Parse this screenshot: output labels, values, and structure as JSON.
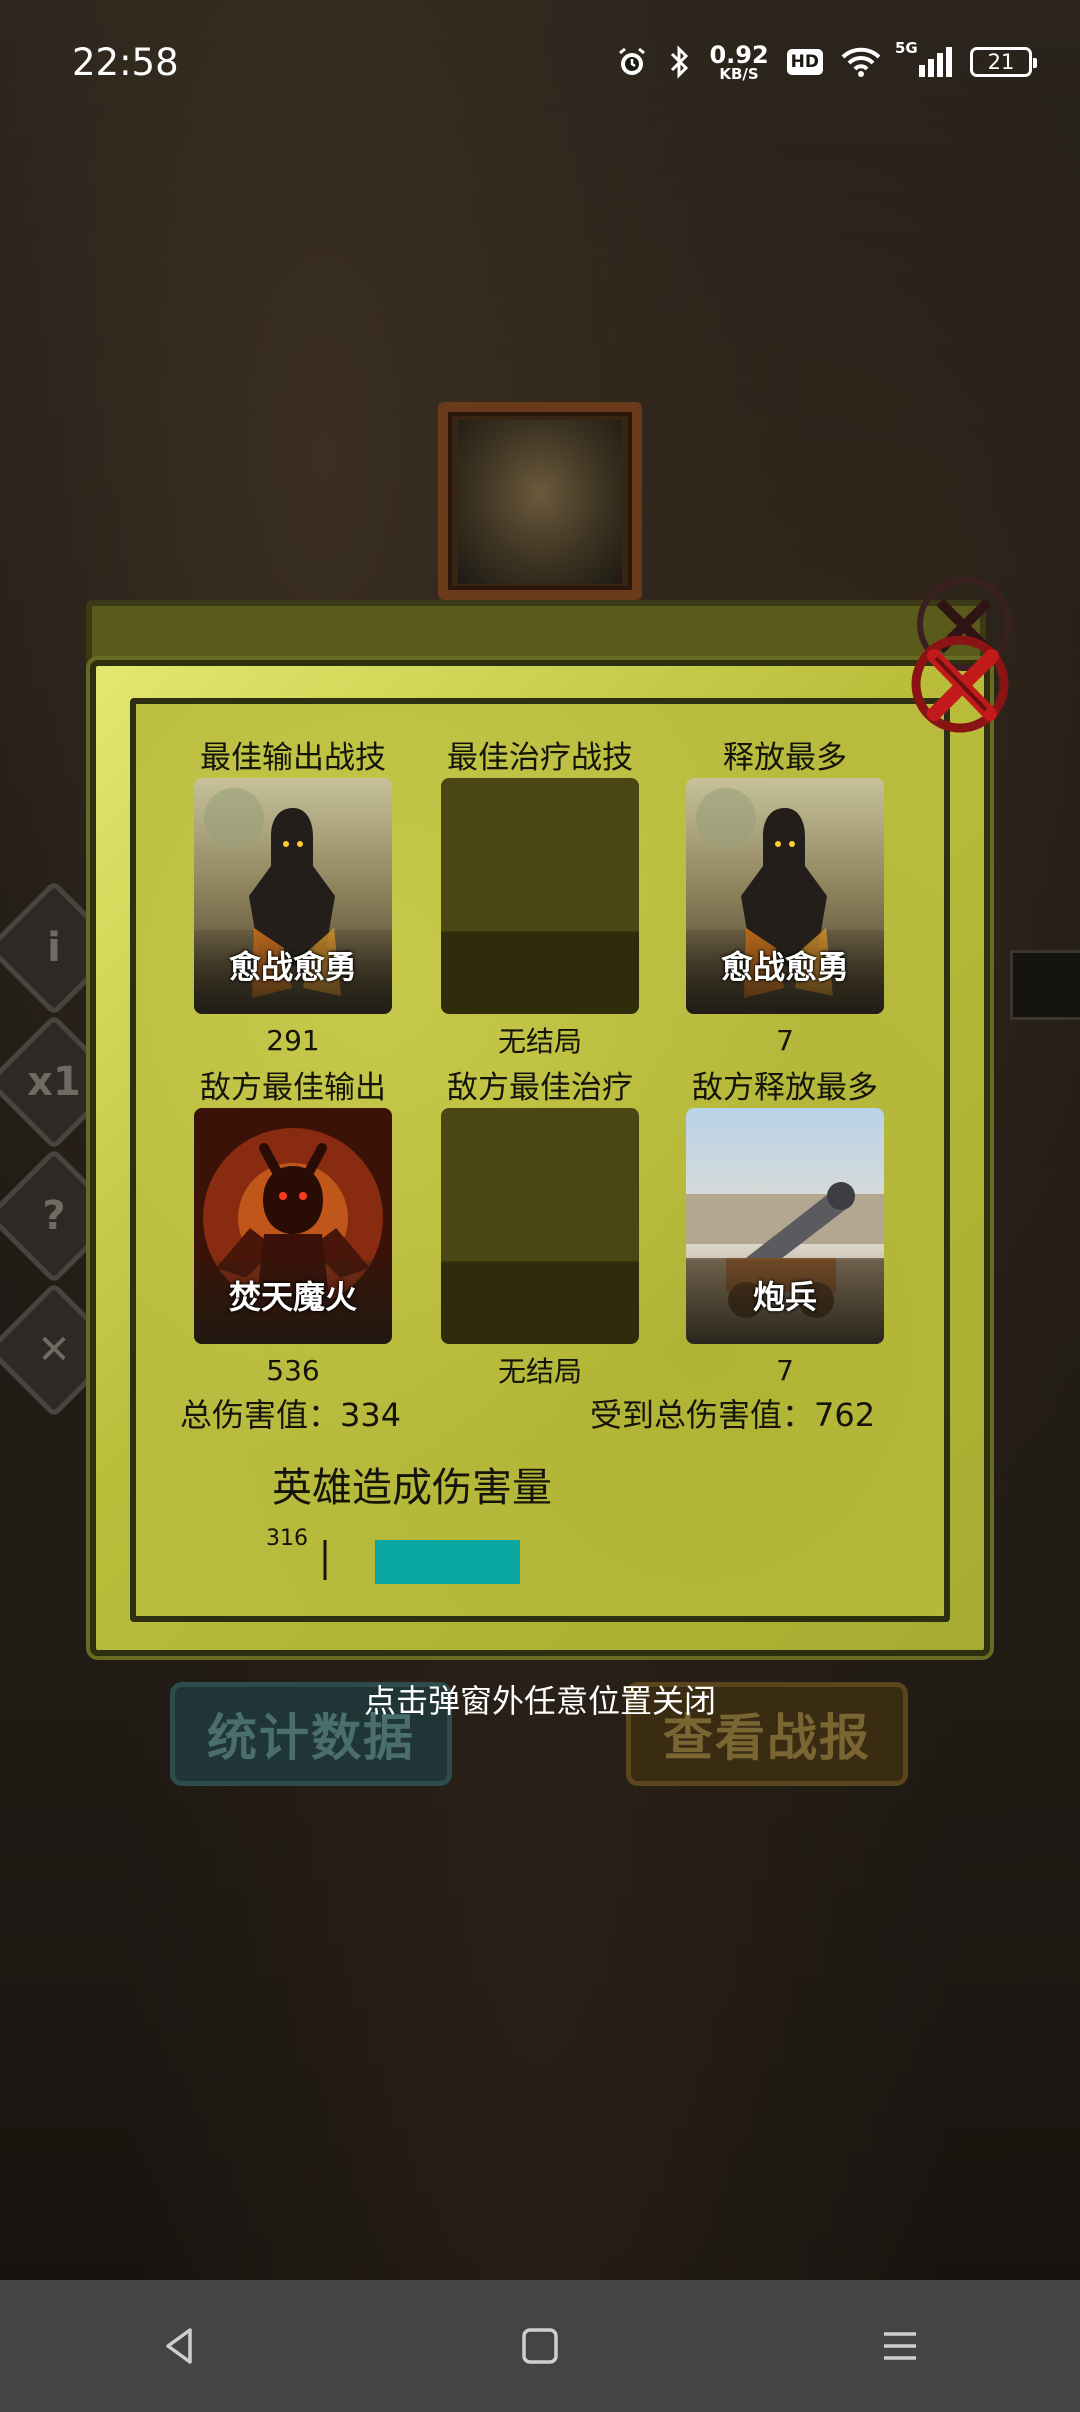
{
  "status_bar": {
    "time": "22:58",
    "net_speed_value": "0.92",
    "net_speed_unit": "KB/S",
    "hd_label": "HD",
    "network_label": "5G",
    "battery": "21"
  },
  "background": {
    "side_buttons": [
      "i",
      "x1",
      "?",
      "✕"
    ],
    "stats_button": "统计数据",
    "report_button": "查看战报"
  },
  "modal": {
    "slots": [
      {
        "title": "最佳输出战技",
        "name": "愈战愈勇",
        "value": "291",
        "art": "hooded-warrior"
      },
      {
        "title": "最佳治疗战技",
        "name": "",
        "value": "无结局",
        "art": "empty"
      },
      {
        "title": "释放最多",
        "name": "愈战愈勇",
        "value": "7",
        "art": "hooded-warrior"
      },
      {
        "title": "敌方最佳输出",
        "name": "焚天魔火",
        "value": "536",
        "art": "fire-demon"
      },
      {
        "title": "敌方最佳治疗",
        "name": "",
        "value": "无结局",
        "art": "empty"
      },
      {
        "title": "敌方释放最多",
        "name": "炮兵",
        "value": "7",
        "art": "cannon"
      }
    ],
    "total_damage": "总伤害值：334",
    "total_taken": "受到总伤害值：762",
    "chart_title": "英雄造成伤害量",
    "close_icon": "close-x-icon"
  },
  "chart_data": {
    "type": "bar",
    "title": "英雄造成伤害量",
    "categories": [
      ""
    ],
    "values": [
      316
    ],
    "axis_label": "316",
    "bar_color": "#0aa7a0"
  },
  "hint": "点击弹窗外任意位置关闭",
  "nav": {
    "back_icon": "back-triangle-icon",
    "home_icon": "home-square-icon",
    "menu_icon": "menu-lines-icon"
  }
}
